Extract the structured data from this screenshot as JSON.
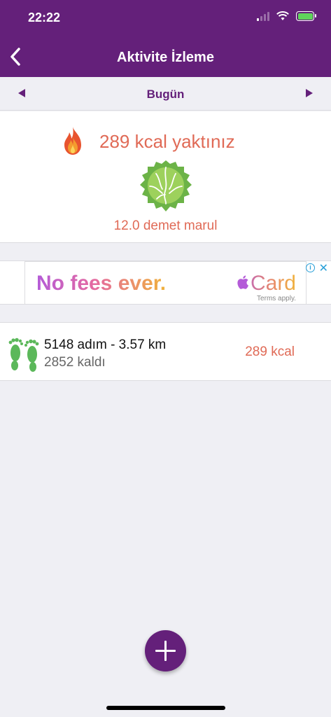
{
  "status_bar": {
    "time": "22:22"
  },
  "nav": {
    "title": "Aktivite İzleme",
    "back_icon": "chevron-left-icon"
  },
  "day_selector": {
    "label": "Bugün",
    "prev_icon": "triangle-left-icon",
    "next_icon": "triangle-right-icon"
  },
  "summary": {
    "burned_text": "289 kcal yaktınız",
    "equivalent_text": "12.0 demet marul",
    "fire_icon": "fire-icon",
    "food_icon": "lettuce-icon"
  },
  "ad": {
    "headline": "No fees ever.",
    "brand": "Card",
    "terms": "Terms apply."
  },
  "activity": {
    "steps_text": "5148 adım - 3.57 km",
    "remaining_text": "2852 kaldı",
    "kcal_text": "289 kcal",
    "icon": "footprints-icon"
  },
  "fab": {
    "icon": "plus-icon"
  },
  "colors": {
    "primary": "#64207a",
    "accent": "#e06a56",
    "green": "#5bb85a",
    "background": "#efeff4"
  }
}
